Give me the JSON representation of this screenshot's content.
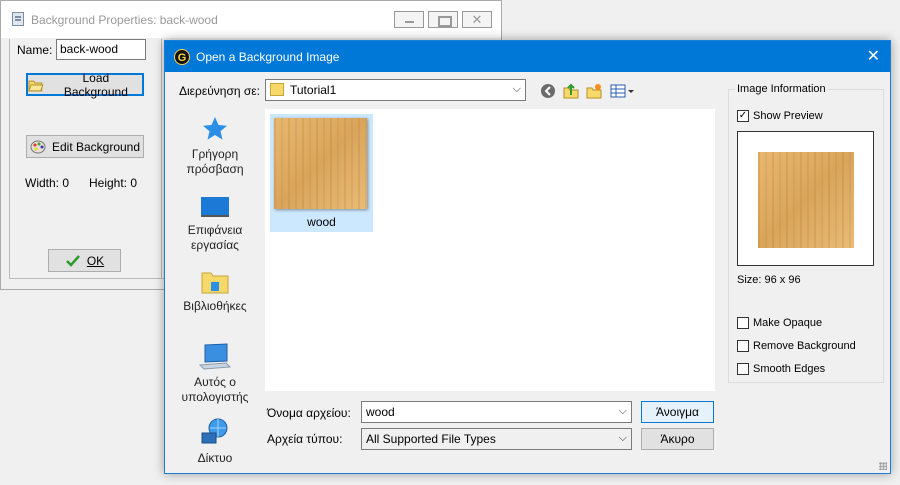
{
  "bg_window": {
    "title": "Background Properties: back-wood",
    "name_label": "Name:",
    "name_value": "back-wood",
    "load_button": "Load Background",
    "edit_button": "Edit Background",
    "width_text": "Width: 0",
    "height_text": "Height: 0",
    "ok_button": "OK",
    "close_glyph": "✕"
  },
  "dialog": {
    "title": "Open a Background Image",
    "close_glyph": "✕",
    "lookin_label": "Διερεύνηση σε:",
    "lookin_value": "Tutorial1",
    "places": [
      {
        "label": "Γρήγορη πρόσβαση",
        "icon": "star-icon"
      },
      {
        "label": "Επιφάνεια εργασίας",
        "icon": "desktop-icon"
      },
      {
        "label": "Βιβλιοθήκες",
        "icon": "library-icon"
      },
      {
        "label": "Αυτός ο υπολογιστής",
        "icon": "computer-icon"
      },
      {
        "label": "Δίκτυο",
        "icon": "network-icon"
      }
    ],
    "files": [
      {
        "name": "wood"
      }
    ],
    "filename_label": "Όνομα αρχείου:",
    "filename_value": "wood",
    "filetype_label": "Αρχεία τύπου:",
    "filetype_value": "All Supported File Types",
    "open_button": "Άνοιγμα",
    "cancel_button": "Άκυρο",
    "info": {
      "legend": "Image Information",
      "show_preview": "Show Preview",
      "show_preview_checked": true,
      "size_text": "Size: 96 x 96",
      "make_opaque": "Make Opaque",
      "remove_background": "Remove Background",
      "smooth_edges": "Smooth Edges"
    }
  },
  "colors": {
    "accent": "#0078d7",
    "selection": "#cce8ff",
    "folder": "#f6d86b"
  }
}
